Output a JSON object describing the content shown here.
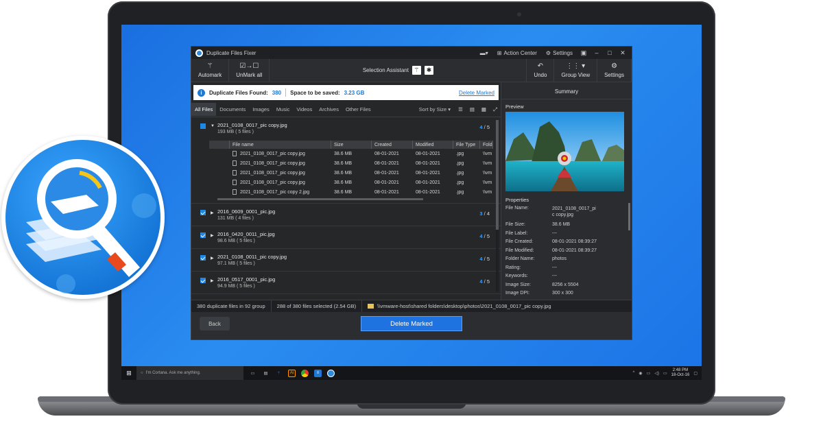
{
  "window": {
    "title": "Duplicate Files Fixer",
    "action_center": "Action Center",
    "settings_menu": "Settings"
  },
  "toolbar": {
    "automark": "Automark",
    "unmark_all": "UnMark all",
    "selection_assistant": "Selection Assistant",
    "undo": "Undo",
    "group_view": "Group View",
    "settings": "Settings"
  },
  "info": {
    "found_label": "Duplicate Files Found:",
    "found_value": "380",
    "space_label": "Space to be saved:",
    "space_value": "3.23 GB",
    "delete_marked_link": "Delete Marked"
  },
  "tabs": [
    "All Files",
    "Documents",
    "Images",
    "Music",
    "Videos",
    "Archives",
    "Other Files"
  ],
  "sort": "Sort by Size",
  "groups": [
    {
      "name": "2021_0108_0017_pic copy.jpg",
      "sub": "193 MB  ( 5 files )",
      "marked": "4",
      "total": "5",
      "expanded": true
    },
    {
      "name": "2016_0609_0001_pic.jpg",
      "sub": "131 MB  ( 4 files )",
      "marked": "3",
      "total": "4"
    },
    {
      "name": "2016_0420_0011_pic.jpg",
      "sub": "98.6 MB  ( 5 files )",
      "marked": "4",
      "total": "5"
    },
    {
      "name": "2021_0108_0011_pic copy.jpg",
      "sub": "97.1 MB  ( 5 files )",
      "marked": "4",
      "total": "5"
    },
    {
      "name": "2016_0517_0001_pic.jpg",
      "sub": "94.9 MB  ( 5 files )",
      "marked": "4",
      "total": "5"
    }
  ],
  "subtable": {
    "headers": [
      "File name",
      "Size",
      "Created",
      "Modified",
      "File Type",
      "Folde"
    ],
    "rows": [
      {
        "name": "2021_0108_0017_pic copy.jpg",
        "size": "38.6 MB",
        "created": "08-01-2021",
        "modified": "08-01-2021",
        "type": ".jpg",
        "folder": "\\\\vm",
        "checked": false
      },
      {
        "name": "2021_0108_0017_pic copy.jpg",
        "size": "38.6 MB",
        "created": "08-01-2021",
        "modified": "08-01-2021",
        "type": ".jpg",
        "folder": "\\\\vm",
        "checked": true
      },
      {
        "name": "2021_0108_0017_pic copy.jpg",
        "size": "38.6 MB",
        "created": "08-01-2021",
        "modified": "08-01-2021",
        "type": ".jpg",
        "folder": "\\\\vm",
        "checked": true
      },
      {
        "name": "2021_0108_0017_pic copy.jpg",
        "size": "38.6 MB",
        "created": "08-01-2021",
        "modified": "08-01-2021",
        "type": ".jpg",
        "folder": "\\\\vm",
        "checked": true
      },
      {
        "name": "2021_0108_0017_pic copy 2.jpg",
        "size": "38.6 MB",
        "created": "08-01-2021",
        "modified": "08-01-2021",
        "type": ".jpg",
        "folder": "\\\\vm",
        "checked": true
      }
    ]
  },
  "summary": {
    "header": "Summary",
    "preview": "Preview",
    "properties": "Properties",
    "items": [
      {
        "k": "File Name:",
        "v": "2021_0108_0017_pi c copy.jpg"
      },
      {
        "k": "File Size:",
        "v": "38.6 MB"
      },
      {
        "k": "File Label:",
        "v": "---"
      },
      {
        "k": "File Created:",
        "v": "08-01-2021 08:39:27"
      },
      {
        "k": "File Modified:",
        "v": "08-01-2021 08:39:27"
      },
      {
        "k": "Folder Name:",
        "v": "photos"
      },
      {
        "k": "Rating:",
        "v": "---"
      },
      {
        "k": "Keywords:",
        "v": "---"
      },
      {
        "k": "Image Size:",
        "v": "8256 x 5504"
      },
      {
        "k": "Image DPI:",
        "v": "300 x 300"
      }
    ]
  },
  "status": {
    "groups": "380 duplicate files in 92 group",
    "selected": "288 of 380 files selected  (2.54 GB)",
    "path": "\\\\vmware-host\\shared folders\\desktop\\photos\\2021_0108_0017_pic copy.jpg"
  },
  "bottom": {
    "back": "Back",
    "delete_marked": "Delete Marked"
  },
  "taskbar": {
    "cortana": "I'm Cortana. Ask me anything.",
    "time": "2:48 PM",
    "date": "18-Oct-16"
  },
  "colors": {
    "accent": "#1f73e0",
    "desktop": "#1c74e6",
    "link": "#1f78d1"
  }
}
